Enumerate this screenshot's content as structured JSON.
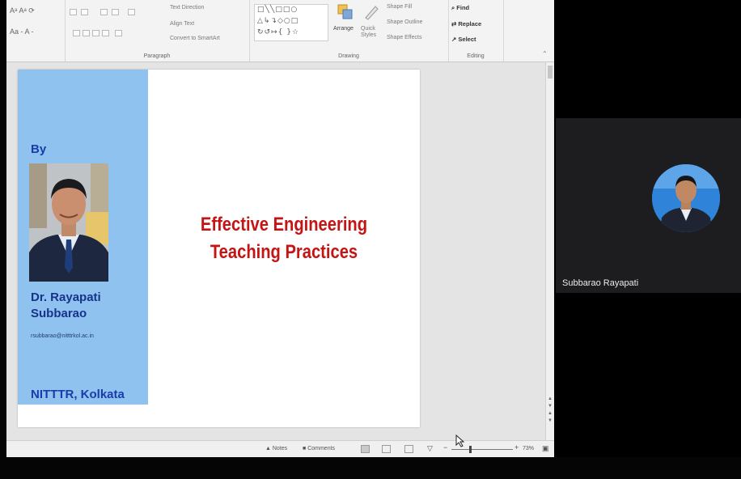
{
  "ribbon": {
    "groups": [
      {
        "id": "paragraph",
        "label": "Paragraph"
      },
      {
        "id": "drawing",
        "label": "Drawing"
      },
      {
        "id": "editing",
        "label": "Editing"
      }
    ],
    "paragraph": {
      "text_direction": "Text Direction",
      "align_text": "Align Text",
      "convert_smartart": "Convert to SmartArt"
    },
    "drawing": {
      "arrange": "Arrange",
      "quick_styles": "Quick Styles",
      "shape_fill": "Shape Fill",
      "shape_outline": "Shape Outline",
      "shape_effects": "Shape Effects"
    },
    "editing": {
      "find": "Find",
      "replace": "Replace",
      "select": "Select"
    }
  },
  "slide": {
    "by_label": "By",
    "author_line1": "Dr. Rayapati",
    "author_line2": "Subbarao",
    "email": "rsubbarao@nitttrkol.ac.in",
    "institute": "NITTTR, Kolkata",
    "title_line1": "Effective Engineering",
    "title_line2": "Teaching Practices",
    "panel_color": "#8fc2ef",
    "title_color": "#c41414"
  },
  "status_bar": {
    "notes": "Notes",
    "comments": "Comments",
    "zoom": "73%"
  },
  "participant": {
    "name": "Subbarao Rayapati"
  }
}
